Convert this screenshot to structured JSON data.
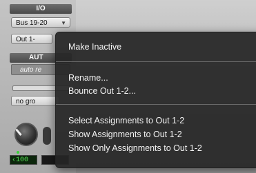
{
  "io": {
    "header": "I/O",
    "input_selector": "Bus 19-20",
    "output_selector": "Out 1-"
  },
  "automation": {
    "header": "AUT",
    "mode": "auto re"
  },
  "group": {
    "selector": "no gro"
  },
  "pan": {
    "value": "‹100"
  },
  "context_menu": {
    "make_inactive": "Make Inactive",
    "rename": "Rename...",
    "bounce": "Bounce Out 1-2...",
    "select_assignments": "Select Assignments to Out 1-2",
    "show_assignments": "Show Assignments to Out 1-2",
    "show_only_assignments": "Show Only Assignments to Out 1-2"
  }
}
